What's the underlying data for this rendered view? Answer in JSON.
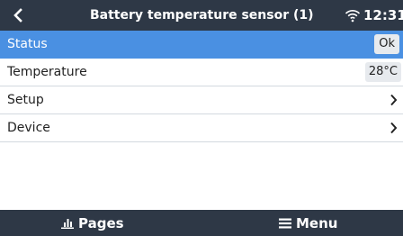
{
  "header": {
    "back_icon": "chevron-left-icon",
    "title": "Battery temperature sensor (1)",
    "wifi_icon": "wifi-icon",
    "time": "12:31"
  },
  "items": [
    {
      "label": "Status",
      "value": "Ok",
      "selected": true
    },
    {
      "label": "Temperature",
      "value": "28°C",
      "selected": false
    },
    {
      "label": "Setup",
      "icon": "chevron-right-icon"
    },
    {
      "label": "Device",
      "icon": "chevron-right-icon"
    }
  ],
  "footer": {
    "pages_label": "Pages",
    "pages_icon": "bar-chart-icon",
    "menu_label": "Menu",
    "menu_icon": "hamburger-icon"
  },
  "colors": {
    "bar_background": "#2e3846",
    "selected_row": "#4a90e2",
    "value_badge": "#e7eaee"
  }
}
